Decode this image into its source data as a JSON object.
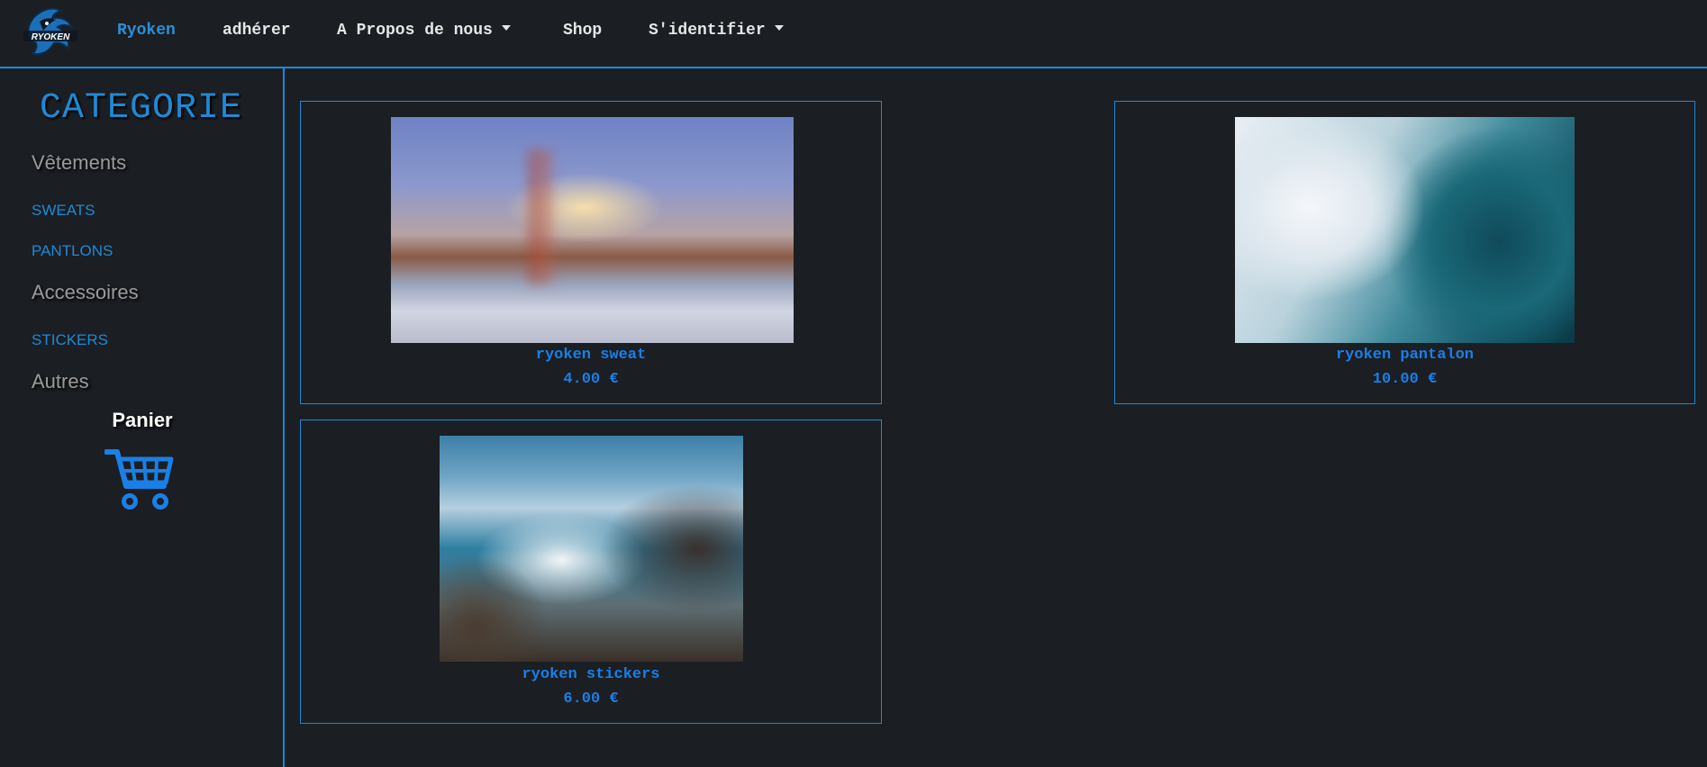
{
  "nav": {
    "logo_text": "RYOKEN",
    "items": [
      {
        "label": "Ryoken",
        "active": true
      },
      {
        "label": "adhérer"
      },
      {
        "label": "A Propos de nous",
        "dropdown": true
      },
      {
        "label": "Shop"
      },
      {
        "label": "S'identifier",
        "dropdown": true
      }
    ]
  },
  "sidebar": {
    "title": "CATEGORIE",
    "sections": [
      {
        "heading": "Vêtements",
        "links": [
          "SWEATS",
          "PANTLONS"
        ]
      },
      {
        "heading": "Accessoires",
        "links": [
          "STICKERS"
        ]
      },
      {
        "heading": "Autres",
        "links": []
      }
    ],
    "cart_label": "Panier",
    "cart_icon": "shopping-cart-icon"
  },
  "products": [
    {
      "name": "ryoken sweat",
      "price": "4.00 €",
      "image": "golden-gate-bridge-blurred"
    },
    {
      "name": "ryoken pantalon",
      "price": "10.00 €",
      "image": "ocean-wave-blurred"
    },
    {
      "name": "ryoken stickers",
      "price": "6.00 €",
      "image": "coastal-rocks-blurred"
    }
  ],
  "colors": {
    "background": "#1b1e23",
    "accent": "#1e8ad6",
    "price_text": "#1a7fe6",
    "muted_heading": "#9a9a9a"
  }
}
